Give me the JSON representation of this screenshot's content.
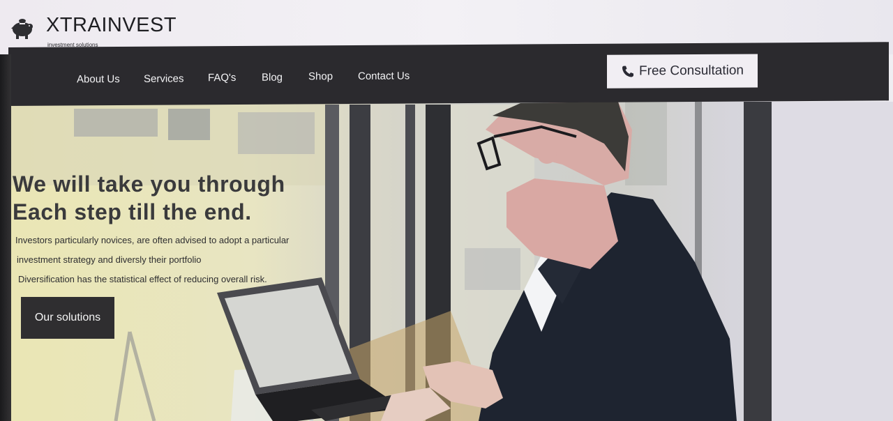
{
  "brand": {
    "name": "XTRAINVEST",
    "tagline": "investment solutions",
    "logo_icon": "piggy-bank-icon"
  },
  "nav": {
    "items": [
      {
        "label": "About Us"
      },
      {
        "label": "Services"
      },
      {
        "label": "FAQ's"
      },
      {
        "label": "Blog"
      },
      {
        "label": "Shop"
      },
      {
        "label": "Contact Us"
      }
    ],
    "cta": {
      "label": "Free Consultation",
      "icon": "phone-icon"
    }
  },
  "hero": {
    "headline_line1": "We will take you through",
    "headline_line2": "Each step till the end.",
    "body_lines": [
      "Investors particularly novices, are often advised to adopt a particular",
      "investment strategy and diversly their portfolio",
      "Diversification has the statistical effect of reducing overall risk."
    ],
    "cta_label": "Our solutions"
  },
  "colors": {
    "nav_background": "#2b2a2e",
    "cta_background": "#2f2e30",
    "button_light": "#f1eef3",
    "headline": "#3a3a3c"
  }
}
